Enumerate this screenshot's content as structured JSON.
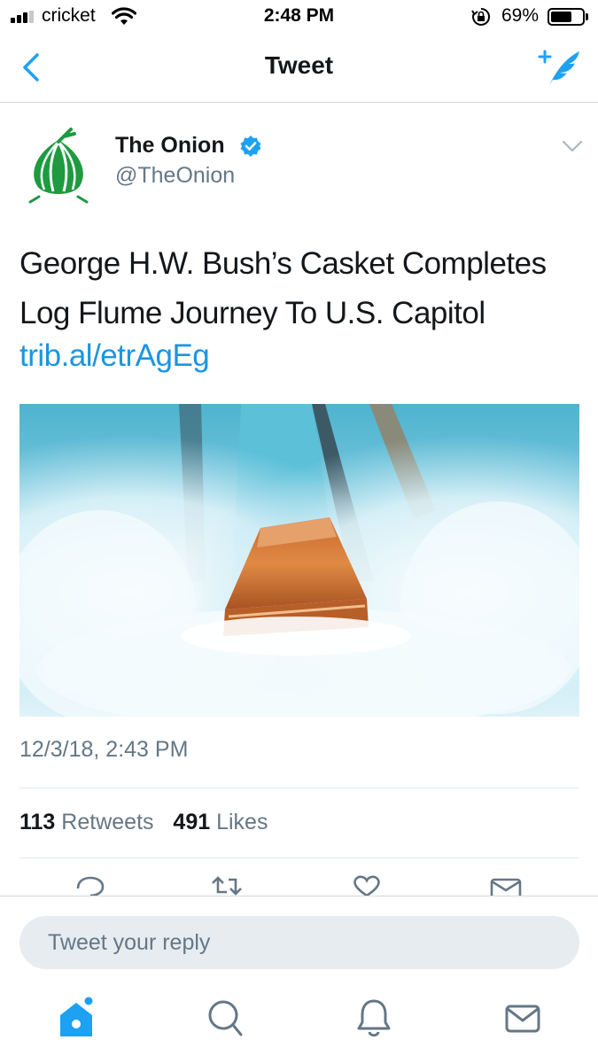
{
  "status_bar": {
    "carrier": "cricket",
    "time": "2:48 PM",
    "battery_percent": "69%",
    "battery_level": 0.69,
    "signal_bars": 3,
    "signal_bars_total": 4
  },
  "nav": {
    "title": "Tweet",
    "back_icon": "chevron-left-icon",
    "compose_icon": "compose-tweet-icon"
  },
  "tweet": {
    "author_name": "The Onion",
    "author_handle": "@TheOnion",
    "verified": true,
    "text": "George H.W. Bush’s Casket Completes Log Flume Journey To U.S. Capitol",
    "link": "trib.al/etrAgEg",
    "timestamp": "12/3/18, 2:43 PM",
    "retweets_count": "113",
    "retweets_label": "Retweets",
    "likes_count": "491",
    "likes_label": "Likes"
  },
  "reply": {
    "placeholder": "Tweet your reply"
  },
  "tab_bar": {
    "items": [
      "home-icon",
      "search-icon",
      "notifications-bell-icon",
      "messages-envelope-icon"
    ]
  },
  "colors": {
    "accent": "#1da1f2",
    "link": "#1b95e0",
    "secondary_text": "#657786",
    "onion_green": "#1e9a3f"
  }
}
